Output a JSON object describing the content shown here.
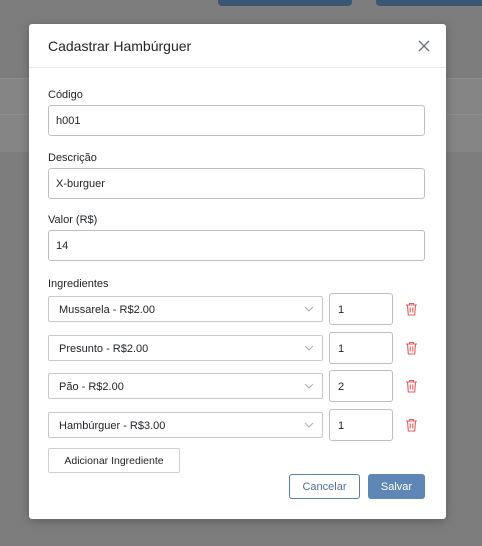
{
  "modal": {
    "title": "Cadastrar Hambúrguer",
    "fields": {
      "codigo": {
        "label": "Código",
        "value": "h001"
      },
      "descricao": {
        "label": "Descrição",
        "value": "X-burguer"
      },
      "valor": {
        "label": "Valor (R$)",
        "value": "14"
      }
    },
    "ingredients_label": "Ingredientes",
    "ingredients": [
      {
        "name": "Mussarela - R$2.00",
        "qty": "1"
      },
      {
        "name": "Presunto - R$2.00",
        "qty": "1"
      },
      {
        "name": "Pão - R$2.00",
        "qty": "2"
      },
      {
        "name": "Hambúrguer - R$3.00",
        "qty": "1"
      }
    ],
    "add_ingredient_label": "Adicionar Ingrediente",
    "cancel_label": "Cancelar",
    "save_label": "Salvar"
  },
  "icons": {
    "close": "close-icon",
    "chevron": "chevron-down-icon",
    "trash": "trash-icon"
  },
  "colors": {
    "primary": "#5f87b5",
    "danger": "#e05c5c",
    "overlay": "#7d7d7d"
  }
}
